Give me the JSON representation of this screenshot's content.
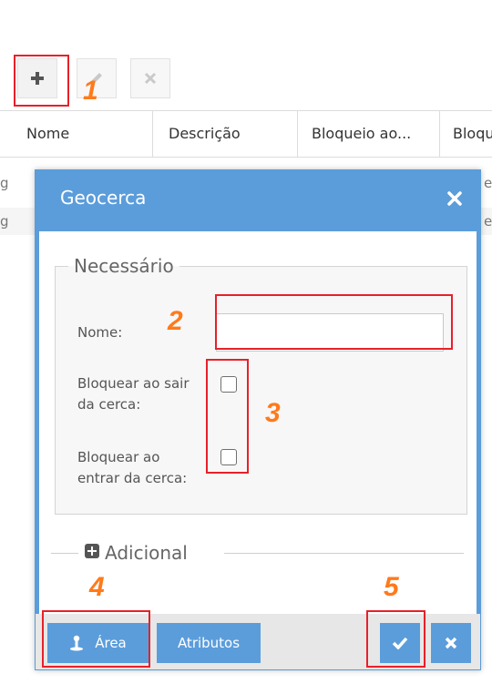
{
  "toolbar": {
    "add_icon": "plus-icon",
    "edit_icon": "pencil-icon",
    "delete_icon": "close-icon"
  },
  "grid": {
    "columns": [
      "Nome",
      "Descrição",
      "Bloqueio ao...",
      "Bloqu"
    ],
    "rows": [
      {
        "first": "g",
        "last": "e"
      },
      {
        "first": "g",
        "last": "e"
      }
    ]
  },
  "dialog": {
    "title": "Geocerca",
    "required_legend": "Necessário",
    "name_label": "Nome:",
    "name_value": "",
    "exit_label_line1": "Bloquear ao sair",
    "exit_label_line2": "da cerca:",
    "exit_checked": false,
    "enter_label_line1": "Bloquear ao",
    "enter_label_line2": "entrar da cerca:",
    "enter_checked": false,
    "additional_label": "Adicional",
    "area_button": "Área",
    "attributes_button": "Atributos",
    "confirm_icon": "check-icon",
    "cancel_icon": "close-icon"
  },
  "annotations": [
    "1",
    "2",
    "3",
    "4",
    "5"
  ],
  "colors": {
    "dialog_blue": "#5b9ddb",
    "annotation_red": "#e8202a",
    "annotation_orange": "#ff7a1a"
  }
}
